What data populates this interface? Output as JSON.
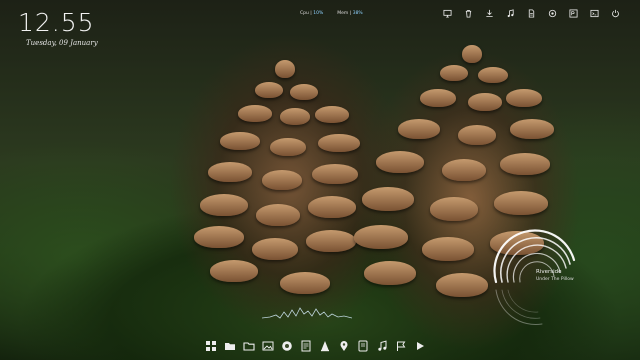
{
  "clock": {
    "time": "12.55",
    "date": "Tuesday, 09 January"
  },
  "stats": {
    "cpu_label": "Cpu",
    "cpu_value": "10%",
    "mem_label": "Mem",
    "mem_value": "38%"
  },
  "top_icons": [
    "monitor-icon",
    "trash-icon",
    "download-icon",
    "music-note-icon",
    "document-icon",
    "settings-icon",
    "photoshop-icon",
    "terminal-icon",
    "power-icon"
  ],
  "music": {
    "title": "Riverside",
    "artist": "Under The Pillow"
  },
  "dock_icons": [
    "apps-grid-icon",
    "folder-icon",
    "folder-open-icon",
    "gallery-icon",
    "browser-icon",
    "files-icon",
    "vlc-icon",
    "pin-icon",
    "notes-icon",
    "music-icon",
    "flag-icon",
    "play-icon"
  ],
  "colors": {
    "accent": "#8fd3ff",
    "text": "#ffffff"
  }
}
